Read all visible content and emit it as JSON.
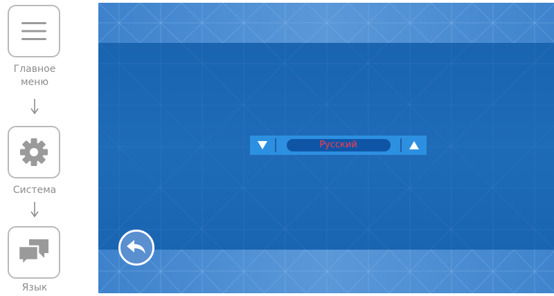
{
  "breadcrumb": {
    "items": [
      {
        "label_line1": "Главное",
        "label_line2": "меню",
        "icon": "hamburger-menu-icon"
      },
      {
        "label": "Система",
        "icon": "gear-icon"
      },
      {
        "label": "Язык",
        "icon": "chat-bubbles-icon"
      }
    ],
    "arrow_icon": "arrow-down-icon"
  },
  "language_selector": {
    "value": "Русский",
    "down_icon": "triangle-down-icon",
    "up_icon": "triangle-up-icon"
  },
  "back_button": {
    "icon": "back-arrow-icon"
  },
  "colors": {
    "screen_background": "#1d6ab6",
    "band_background": "#4a8ed4",
    "selector_background": "#2d8fe0",
    "selected_value_text": "#ff3b4d",
    "breadcrumb_text": "#8c8c8c",
    "breadcrumb_border": "#b9b9b9"
  }
}
